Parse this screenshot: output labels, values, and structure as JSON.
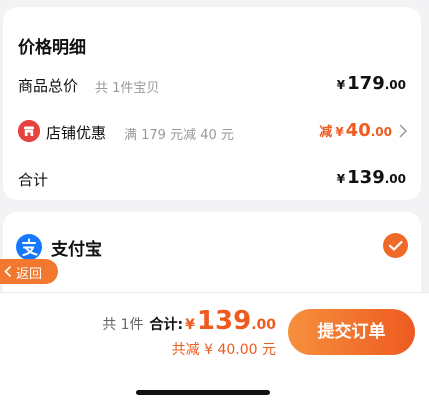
{
  "price_detail": {
    "title": "价格明细",
    "goods_total": {
      "label": "商品总价",
      "sub": "共 1件宝贝",
      "currency": "¥",
      "amount_int": "179",
      "amount_dec": ".00"
    },
    "shop_discount": {
      "label": "店铺优惠",
      "sub": "满 179 元减 40 元",
      "prefix": "减",
      "currency": "¥",
      "amount_int": "40",
      "amount_dec": ".00"
    },
    "total": {
      "label": "合计",
      "currency": "¥",
      "amount_int": "139",
      "amount_dec": ".00"
    }
  },
  "payment": {
    "method_label": "支付宝",
    "selected": true
  },
  "back_button": {
    "label": "返回"
  },
  "bottom_bar": {
    "count_text": "共 1件",
    "total_label": "合计:",
    "currency": "¥",
    "total_int": "139",
    "total_dec": ".00",
    "discount_text": "共减 ¥ 40.00 元",
    "submit_label": "提交订单"
  },
  "colors": {
    "accent": "#ef5a1f",
    "alipay": "#1677ff",
    "shop_icon": "#e64340",
    "background": "#f3f3f5"
  }
}
